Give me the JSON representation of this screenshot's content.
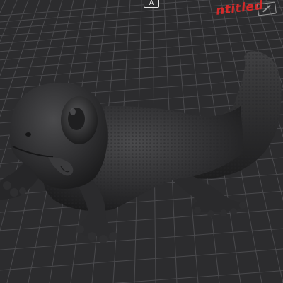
{
  "viewport": {
    "background": "#2c2c2e",
    "grid_color": "#4a4a4d",
    "model_color": "#2f2f31"
  },
  "build_plate": {
    "bed_label": "A",
    "plate_name": "ntitled",
    "plate_name_color": "#d32a2a"
  },
  "model": {
    "icon": "gecko-model"
  }
}
